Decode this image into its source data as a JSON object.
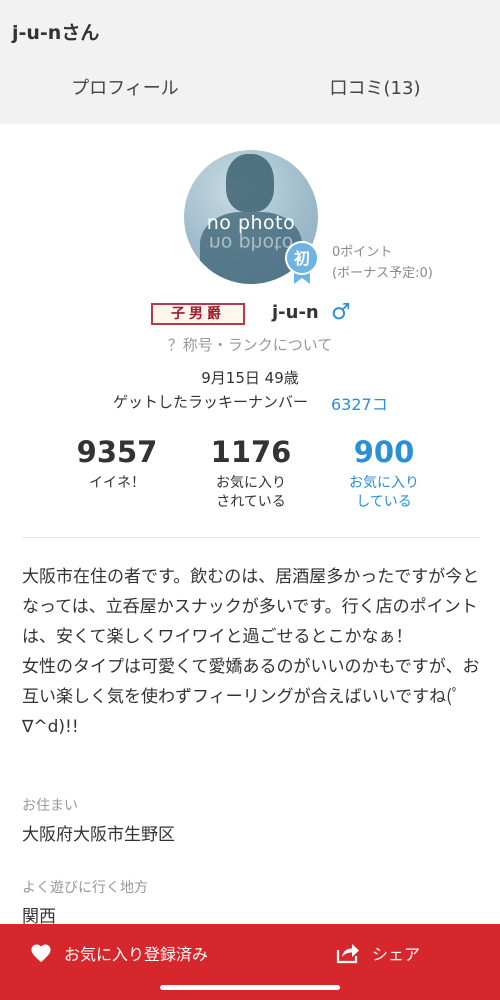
{
  "header": {
    "title": "j-u-nさん"
  },
  "tabs": [
    {
      "label": "プロフィール",
      "active": true
    },
    {
      "label": "口コミ(13)",
      "active": false
    }
  ],
  "profile": {
    "avatar_text": "no photo",
    "first_badge": "初",
    "points": "0ポイント",
    "bonus": "(ボーナス予定:0)",
    "title_badge": "子男爵",
    "username": "j-u-n",
    "gender_symbol": "♂",
    "rank_link": "？称号・ランクについて",
    "birthday": "9月15日 49歳",
    "lucky_label": "ゲットしたラッキーナンバー",
    "lucky_value": "6327コ"
  },
  "stats": {
    "likes": {
      "value": "9357",
      "label": "イイネ！"
    },
    "favorited": {
      "value": "1176",
      "label_line1": "お気に入り",
      "label_line2": "されている"
    },
    "favorites": {
      "value": "900",
      "label_line1": "お気に入り",
      "label_line2": "している"
    }
  },
  "bio": "大阪市在住の者です。飲むのは、居酒屋多かったですが今となっては、立呑屋かスナックが多いです。行く店のポイントは、安くて楽しくワイワイと過ごせるとこかなぁ！\n女性のタイプは可愛くて愛嬌あるのがいいのかもですが、お互い楽しく気を使わずフィーリングが合えばいいですね(ﾟ∇^d)!!",
  "details": {
    "residence_label": "お住まい",
    "residence_value": "大阪府大阪市生野区",
    "area_label": "よく遊びに行く地方",
    "area_value": "関西"
  },
  "bottom_bar": {
    "favorite_label": "お気に入り登録済み",
    "share_label": "シェア"
  },
  "colors": {
    "accent_red": "#d6282c",
    "link_blue": "#2b8fd6"
  }
}
